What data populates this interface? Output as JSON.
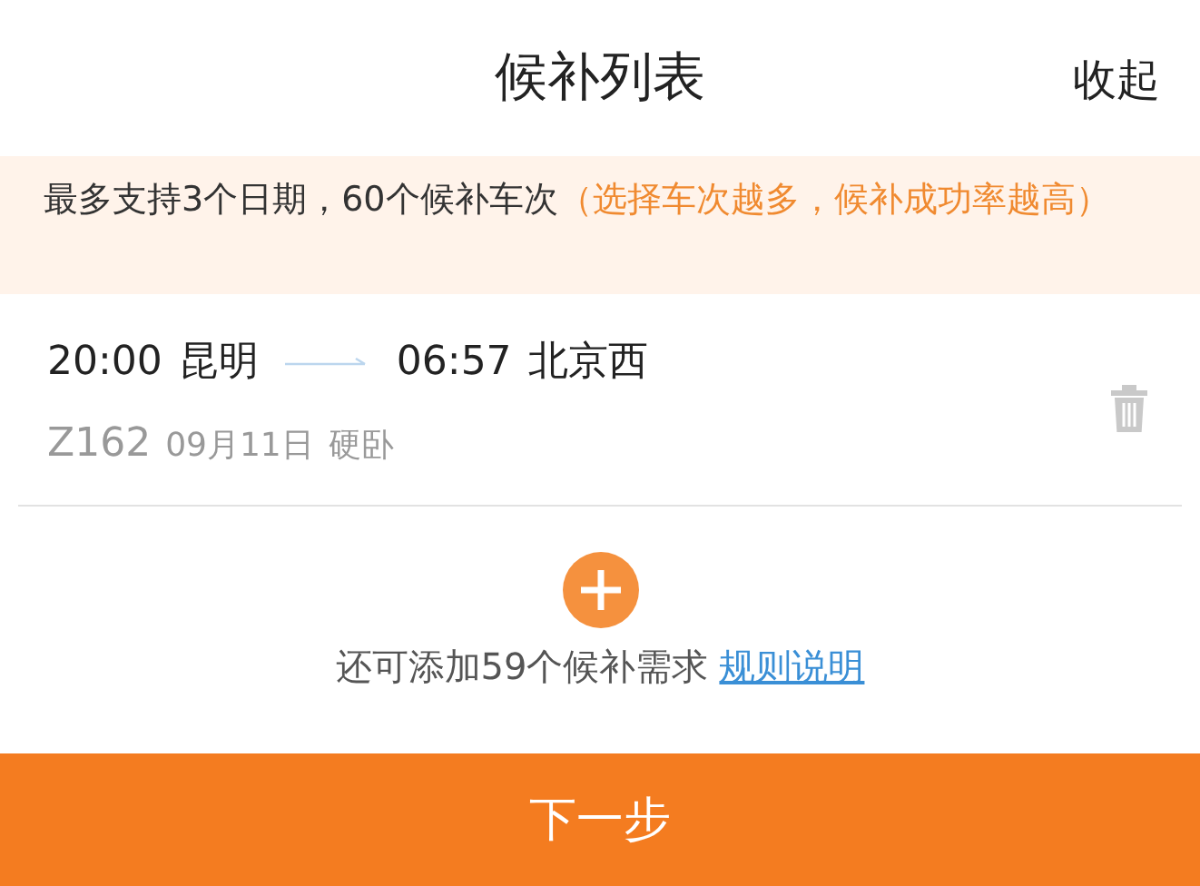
{
  "header": {
    "title": "候补列表",
    "collapse": "收起"
  },
  "notice": {
    "text": "最多支持3个日期，60个候补车次",
    "highlight": "（选择车次越多，候补成功率越高）"
  },
  "trains": [
    {
      "depart_time": "20:00",
      "from": "昆明",
      "arrive_time": "06:57",
      "to": "北京西",
      "number": "Z162",
      "date": "09月11日",
      "seat": "硬卧"
    }
  ],
  "add": {
    "text": "还可添加59个候补需求",
    "link": "规则说明"
  },
  "next_button": "下一步"
}
